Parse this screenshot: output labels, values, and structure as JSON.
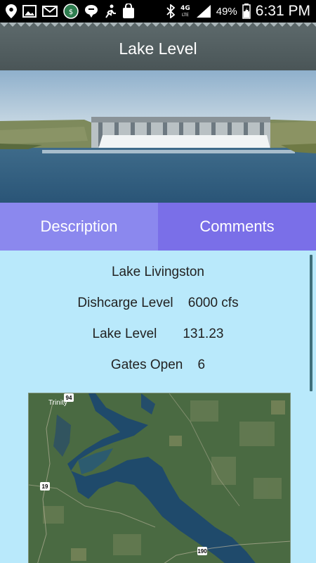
{
  "status_bar": {
    "battery": "49%",
    "time": "6:31 PM",
    "network": "4G LTE"
  },
  "header": {
    "title": "Lake Level"
  },
  "tabs": [
    {
      "label": "Description"
    },
    {
      "label": "Comments"
    }
  ],
  "info": {
    "lake_name": "Lake Livingston",
    "discharge_label": "Dishcarge Level",
    "discharge_value": "6000 cfs",
    "level_label": "Lake Level",
    "level_value": "131.23",
    "gates_label": "Gates Open",
    "gates_value": "6"
  },
  "map": {
    "place_label": "Trinity",
    "shields": [
      "94",
      "19",
      "190"
    ]
  },
  "colors": {
    "background": "#b9e9fb",
    "tab_description": "#8b88ee",
    "tab_comments": "#7a6fe8",
    "header": "#55616a"
  }
}
